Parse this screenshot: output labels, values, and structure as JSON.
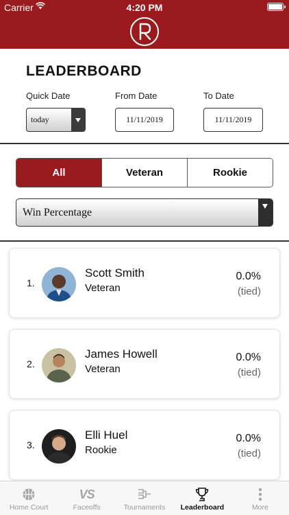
{
  "status_bar": {
    "carrier": "Carrier",
    "time": "4:20 PM"
  },
  "header": {
    "logo_icon": "r-logo-icon",
    "brand_color": "#9b1a1e"
  },
  "page": {
    "title": "LEADERBOARD"
  },
  "filters": {
    "quick_date": {
      "label": "Quick Date",
      "value": "today"
    },
    "from_date": {
      "label": "From Date",
      "value": "11/11/2019"
    },
    "to_date": {
      "label": "To Date",
      "value": "11/11/2019"
    }
  },
  "segments": [
    {
      "label": "All",
      "active": true
    },
    {
      "label": "Veteran",
      "active": false
    },
    {
      "label": "Rookie",
      "active": false
    }
  ],
  "metric": {
    "value": "Win Percentage"
  },
  "leaderboard": [
    {
      "rank": "1.",
      "name": "Scott Smith",
      "tier": "Veteran",
      "percent": "0.0%",
      "note": "(tied)"
    },
    {
      "rank": "2.",
      "name": "James Howell",
      "tier": "Veteran",
      "percent": "0.0%",
      "note": "(tied)"
    },
    {
      "rank": "3.",
      "name": "Elli Huel",
      "tier": "Rookie",
      "percent": "0.0%",
      "note": "(tied)"
    }
  ],
  "tabbar": {
    "items": [
      {
        "label": "Home Court",
        "icon": "basketball-icon",
        "active": false
      },
      {
        "label": "Faceoffs",
        "icon": "vs-icon",
        "icon_text": "VS",
        "active": false
      },
      {
        "label": "Tournaments",
        "icon": "bracket-icon",
        "active": false
      },
      {
        "label": "Leaderboard",
        "icon": "trophy-icon",
        "active": true
      },
      {
        "label": "More",
        "icon": "more-vertical-icon",
        "active": false
      }
    ]
  }
}
